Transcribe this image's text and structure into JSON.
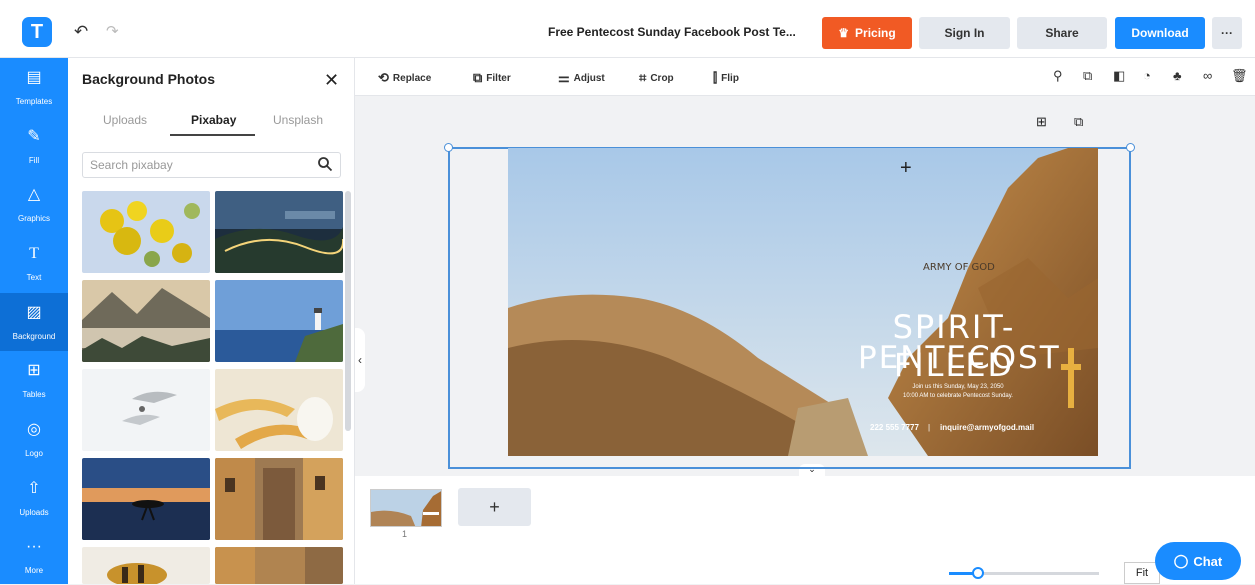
{
  "app": {
    "logo": "T"
  },
  "header": {
    "title": "Free Pentecost Sunday Facebook Post Te...",
    "pricing": "Pricing",
    "signin": "Sign In",
    "share": "Share",
    "download": "Download",
    "more": "···"
  },
  "sidebar": {
    "items": [
      {
        "label": "Templates",
        "icon": "templates-icon"
      },
      {
        "label": "Fill",
        "icon": "pen-icon"
      },
      {
        "label": "Graphics",
        "icon": "shapes-icon"
      },
      {
        "label": "Text",
        "icon": "text-icon"
      },
      {
        "label": "Background",
        "icon": "background-icon"
      },
      {
        "label": "Tables",
        "icon": "table-icon"
      },
      {
        "label": "Logo",
        "icon": "logo-icon"
      },
      {
        "label": "Uploads",
        "icon": "upload-icon"
      },
      {
        "label": "More",
        "icon": "more-icon"
      }
    ],
    "active": "Background"
  },
  "panel": {
    "title": "Background Photos",
    "tabs": [
      "Uploads",
      "Pixabay",
      "Unsplash"
    ],
    "active_tab": "Pixabay",
    "search_placeholder": "Search pixabay"
  },
  "toolbar": {
    "replace": "Replace",
    "filter": "Filter",
    "adjust": "Adjust",
    "crop": "Crop",
    "flip": "Flip"
  },
  "design": {
    "org": "ARMY OF GOD",
    "headline1": "SPIRIT-FILLED",
    "headline2": "PENTECOST",
    "line1": "Join us this Sunday, May 23, 2050",
    "line2": "10:00 AM to celebrate Pentecost Sunday.",
    "phone": "222 555 7777",
    "separator": "|",
    "email": "inquire@armyofgod.mail"
  },
  "pages": {
    "page_number": "1",
    "add": "+"
  },
  "zoom": {
    "fit_label": "Fit",
    "level": 0.15
  },
  "chat": {
    "label": "Chat"
  },
  "colors": {
    "accent": "#1a8cff",
    "pricing": "#f15a24"
  }
}
